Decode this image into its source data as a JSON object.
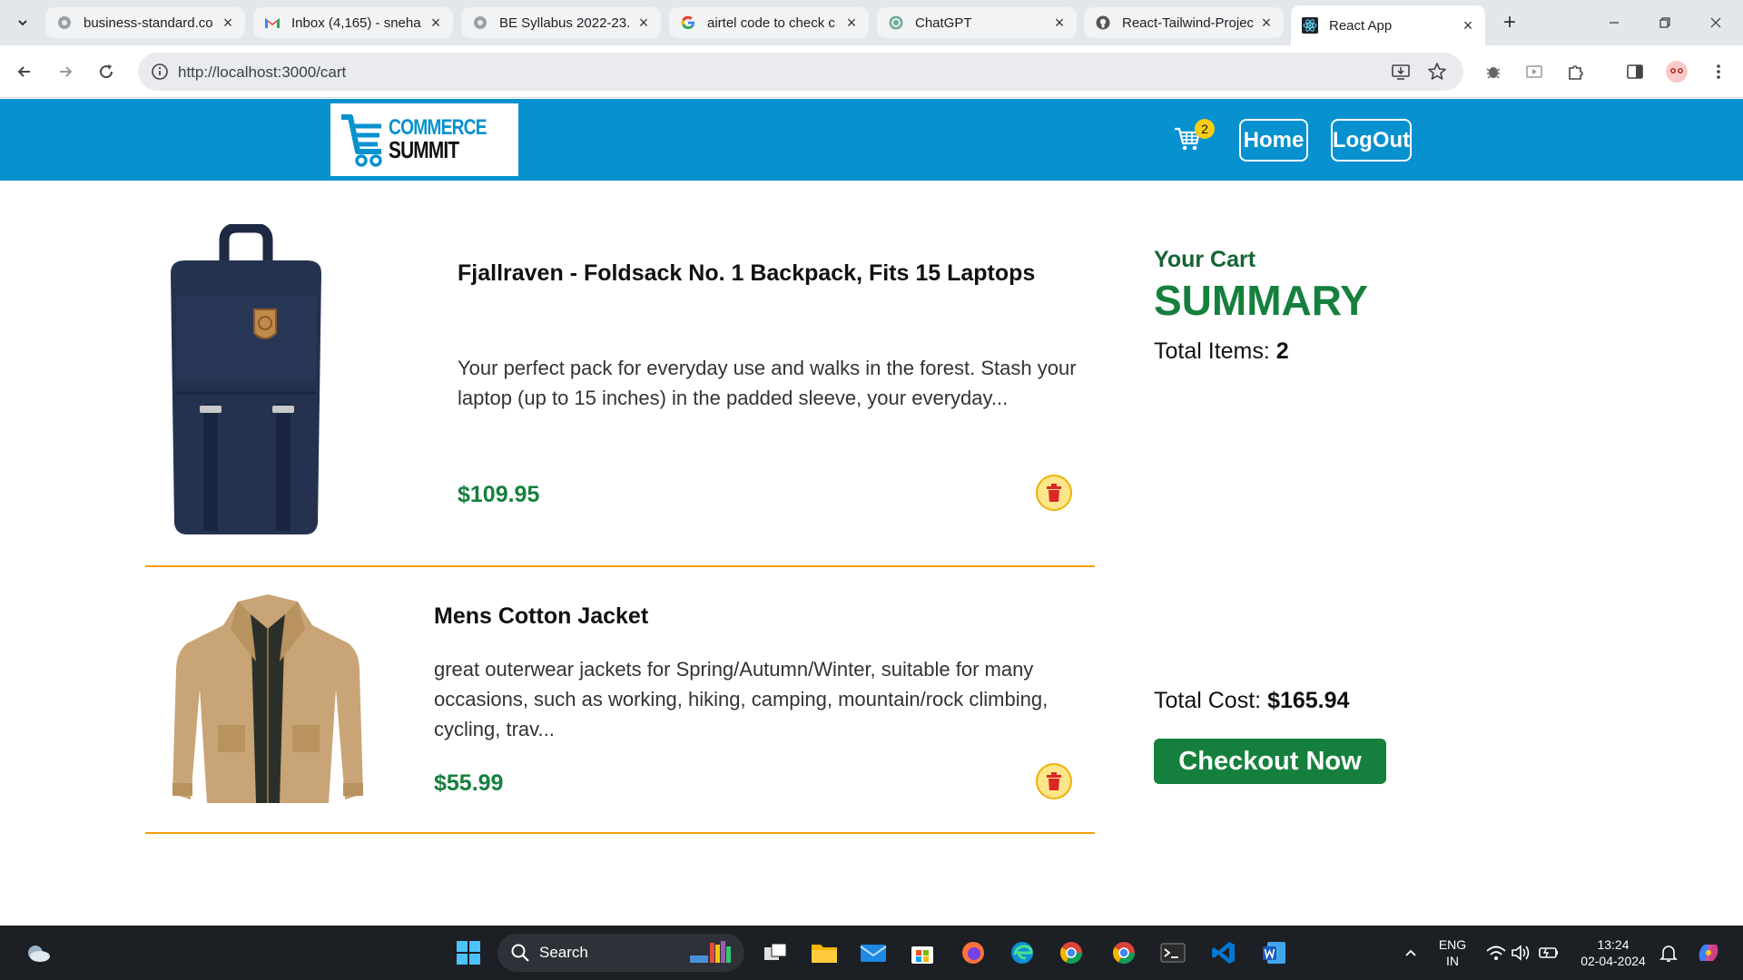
{
  "browser": {
    "tabs": [
      {
        "title": "business-standard.co",
        "favicon": "globe-icon"
      },
      {
        "title": "Inbox (4,165) - sneha",
        "favicon": "gmail-icon"
      },
      {
        "title": "BE Syllabus 2022-23.",
        "favicon": "globe-icon"
      },
      {
        "title": "airtel code to check c",
        "favicon": "google-icon"
      },
      {
        "title": "ChatGPT",
        "favicon": "chatgpt-icon"
      },
      {
        "title": "React-Tailwind-Projec",
        "favicon": "github-icon"
      },
      {
        "title": "React App",
        "favicon": "react-icon"
      }
    ],
    "url": "http://localhost:3000/cart"
  },
  "header": {
    "logo_top": "COMMERCE",
    "logo_bottom": "SUMMIT",
    "cart_count": "2",
    "home_label": "Home",
    "logout_label": "LogOut"
  },
  "cart": {
    "items": [
      {
        "title": "Fjallraven - Foldsack No. 1 Backpack, Fits 15 Laptops",
        "description": "Your perfect pack for everyday use and walks in the forest. Stash your laptop (up to 15 inches) in the padded sleeve, your everyday...",
        "price": "$109.95"
      },
      {
        "title": "Mens Cotton Jacket",
        "description": "great outerwear jackets for Spring/Autumn/Winter, suitable for many occasions, such as working, hiking, camping, mountain/rock climbing, cycling, trav...",
        "price": "$55.99"
      }
    ]
  },
  "summary": {
    "label": "Your Cart",
    "heading": "SUMMARY",
    "items_label": "Total Items:",
    "items_value": "2",
    "cost_label": "Total Cost:",
    "cost_value": "$165.94",
    "checkout_label": "Checkout Now"
  },
  "taskbar": {
    "search_label": "Search",
    "lang_line1": "ENG",
    "lang_line2": "IN",
    "time": "13:24",
    "date": "02-04-2024"
  },
  "colors": {
    "header": "#0891cf",
    "accent_green": "#15803d",
    "divider": "#f59e0b"
  }
}
